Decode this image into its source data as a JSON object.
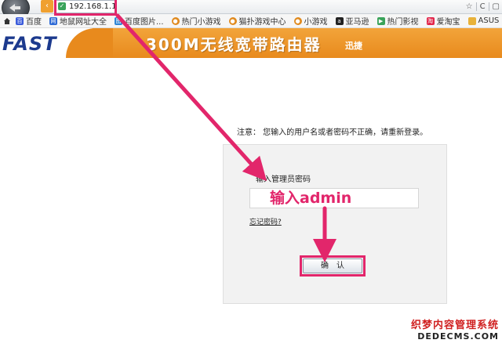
{
  "browser": {
    "url": "192.168.1.1",
    "controls": [
      "☆",
      "|",
      "C",
      "|"
    ]
  },
  "bookmarks": [
    {
      "label": "百度",
      "icon": "baidu-icon",
      "color": "#3b5bdb"
    },
    {
      "label": "地鼠网址大全",
      "icon": "site-icon",
      "color": "#2f6bd6"
    },
    {
      "label": "百度图片...",
      "icon": "image-icon",
      "color": "#2f86d6"
    },
    {
      "label": "热门小游戏",
      "icon": "game-icon",
      "color": "#e08a1e"
    },
    {
      "label": "猫扑游戏中心",
      "icon": "game-center-icon",
      "color": "#e08a1e"
    },
    {
      "label": "小游戏",
      "icon": "small-game-icon",
      "color": "#e08a1e"
    },
    {
      "label": "亚马逊",
      "icon": "amazon-icon",
      "color": "#222222"
    },
    {
      "label": "热门影视",
      "icon": "video-icon",
      "color": "#3aa35a"
    },
    {
      "label": "爱淘宝",
      "icon": "taobao-icon",
      "color": "#e2264b"
    },
    {
      "label": "ASUS E-Ser...",
      "icon": "folder-icon",
      "color": "#e8b23a"
    }
  ],
  "header": {
    "logo": "FAST",
    "title": "300M无线宽带路由器",
    "brand": "迅捷",
    "accent": "#e88a1d"
  },
  "content": {
    "notice": "注意：  您输入的用户名或者密码不正确，请重新登录。",
    "password_label": "输入管理员密码",
    "password_annotation": "输入admin",
    "forgot_link": "忘记密码?",
    "confirm_button": "确认"
  },
  "annotation": {
    "color": "#e2266b"
  },
  "watermark": {
    "line1": "织梦内容管理系统",
    "line2": "DEDECMS.COM"
  }
}
